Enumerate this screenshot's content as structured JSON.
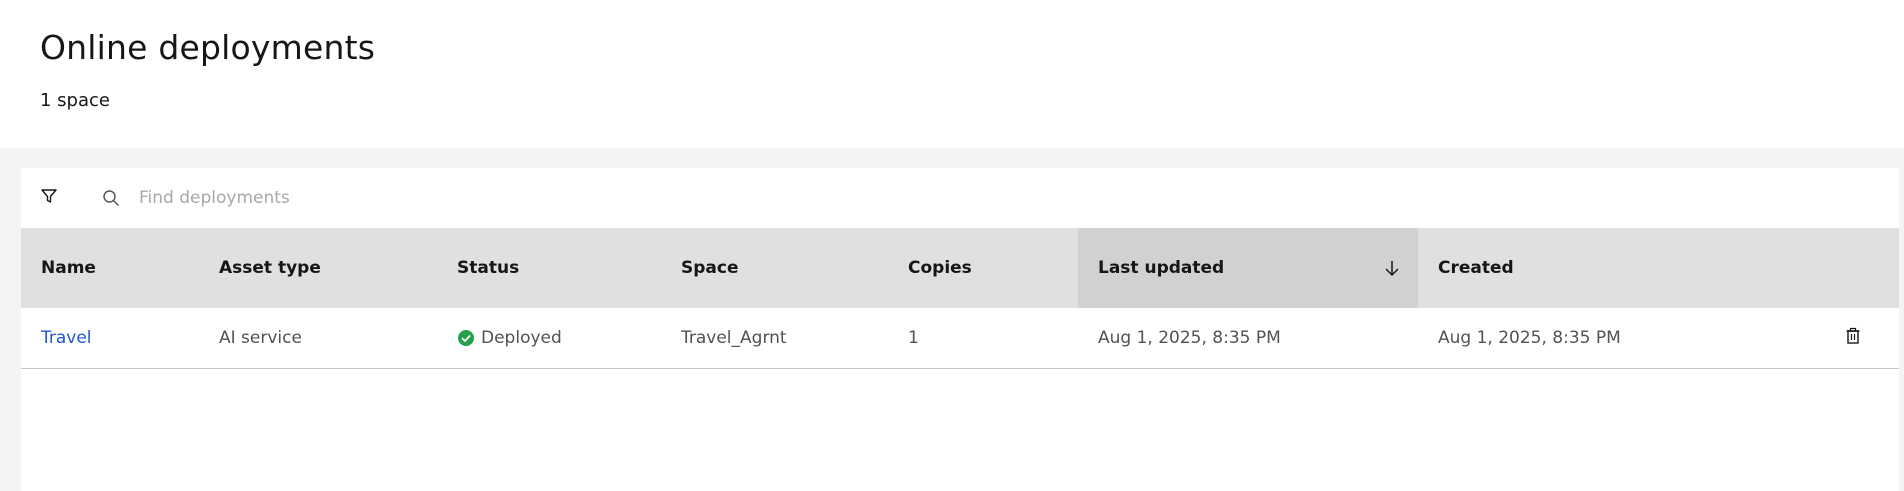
{
  "header": {
    "title": "Online deployments",
    "subtitle": "1 space"
  },
  "toolbar": {
    "filter_icon": "filter-icon",
    "search_icon": "search-icon",
    "search_placeholder": "Find deployments",
    "search_value": ""
  },
  "table": {
    "columns": [
      {
        "label": "Name"
      },
      {
        "label": "Asset type"
      },
      {
        "label": "Status"
      },
      {
        "label": "Space"
      },
      {
        "label": "Copies"
      },
      {
        "label": "Last updated",
        "sorted": "descending",
        "sort_icon": "arrow-down-icon"
      },
      {
        "label": "Created"
      }
    ],
    "rows": [
      {
        "name": "Travel",
        "asset_type": "AI service",
        "status": "Deployed",
        "status_icon": "checkmark-filled-icon",
        "status_color": "#24a148",
        "space": "Travel_Agrnt",
        "copies": "1",
        "last_updated": "Aug 1, 2025, 8:35 PM",
        "created": "Aug 1, 2025, 8:35 PM",
        "action_icon": "trash-can-icon"
      }
    ]
  },
  "colors": {
    "link": "#1f58c7",
    "header_bg": "#e0e0e0",
    "sorted_header_bg": "#d1d1d1",
    "page_bg": "#f4f4f4",
    "success": "#24a148"
  }
}
